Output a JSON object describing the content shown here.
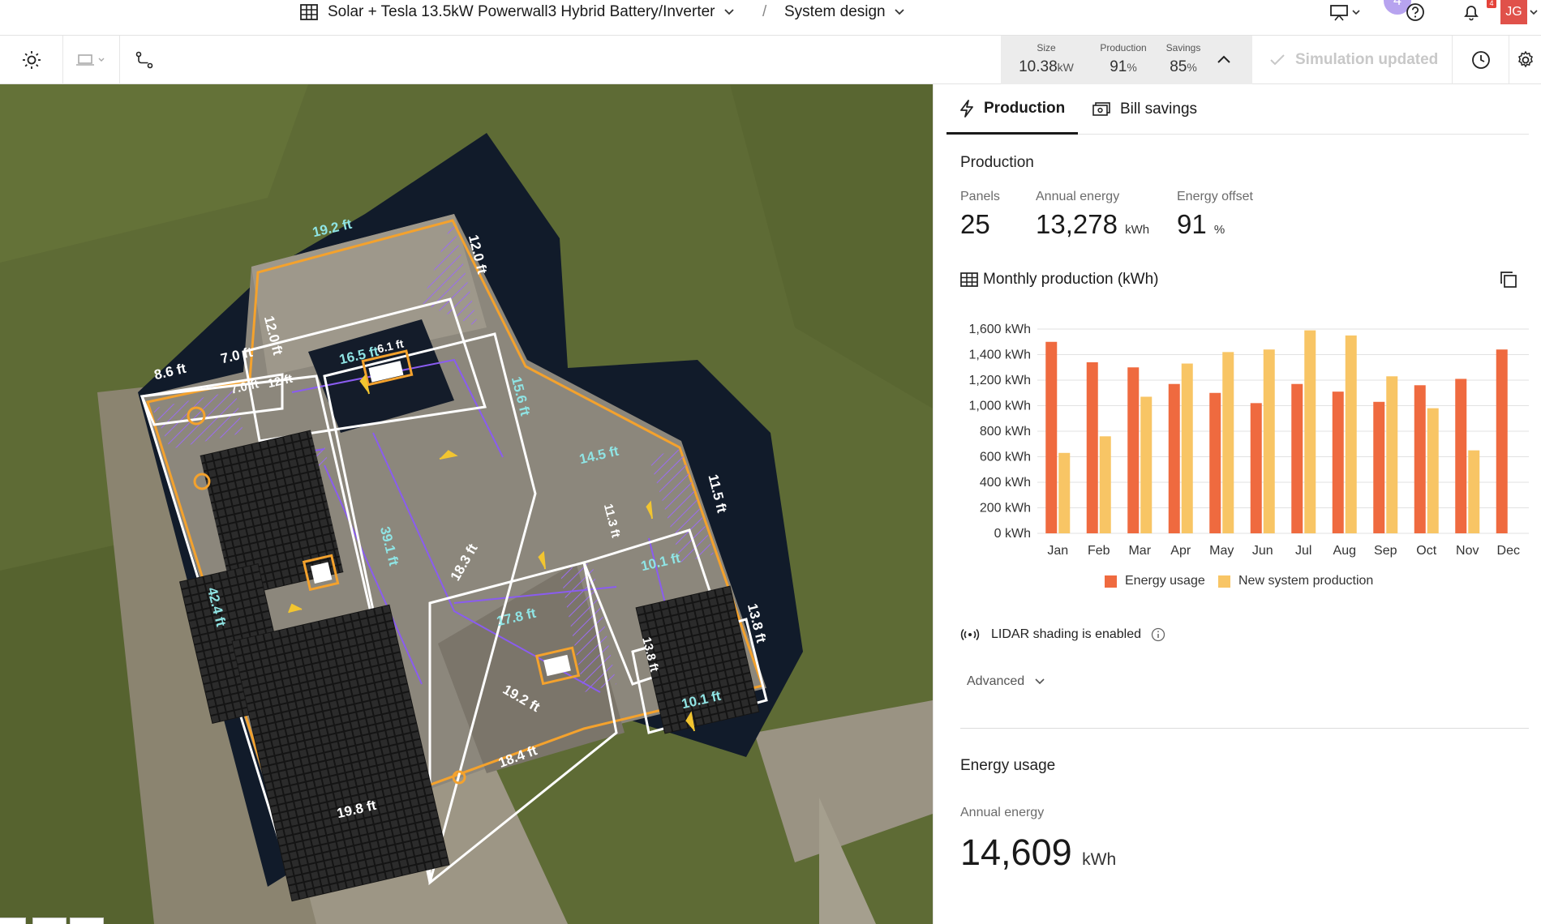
{
  "header": {
    "project_title": "Solar + Tesla 13.5kW Powerwall3 Hybrid Battery/Inverter",
    "separator": "/",
    "section": "System design",
    "badge_count": "4",
    "notification_count": "4",
    "avatar_initials": "JG"
  },
  "toolbar": {
    "stats": [
      {
        "label": "Size",
        "value": "10.38",
        "unit": "kW"
      },
      {
        "label": "Production",
        "value": "91",
        "unit": "%"
      },
      {
        "label": "Savings",
        "value": "85",
        "unit": "%"
      }
    ],
    "simulation_status": "Simulation updated"
  },
  "map": {
    "roof_labels": [
      "19.2 ft",
      "12.0 ft",
      "12.0 ft",
      "8.6 ft",
      "7.0 ft",
      "7.0 ft",
      "12 ft",
      "16.5 ft",
      "6.1 ft",
      "15.6 ft",
      "14.5 ft",
      "11.5 ft",
      "11.3 ft",
      "10.1 ft",
      "39.1 ft",
      "18.3 ft",
      "17.8 ft",
      "42.4 ft",
      "13.8 ft",
      "13.8 ft",
      "10.1 ft",
      "19.2 ft",
      "18.4 ft",
      "19.8 ft"
    ]
  },
  "panel": {
    "tabs": [
      {
        "label": "Production",
        "active": true
      },
      {
        "label": "Bill savings",
        "active": false
      }
    ],
    "production": {
      "title": "Production",
      "metrics": [
        {
          "label": "Panels",
          "value": "25",
          "unit": ""
        },
        {
          "label": "Annual energy",
          "value": "13,278",
          "unit": "kWh"
        },
        {
          "label": "Energy offset",
          "value": "91",
          "unit": "%"
        }
      ],
      "chart_title": "Monthly production (kWh)"
    },
    "lidar_text": "LIDAR shading is enabled",
    "advanced_label": "Advanced",
    "energy_usage": {
      "title": "Energy usage",
      "sub_label": "Annual energy",
      "value": "14,609",
      "unit": "kWh"
    }
  },
  "chart_data": {
    "type": "bar",
    "title": "Monthly production (kWh)",
    "categories": [
      "Jan",
      "Feb",
      "Mar",
      "Apr",
      "May",
      "Jun",
      "Jul",
      "Aug",
      "Sep",
      "Oct",
      "Nov",
      "Dec"
    ],
    "series": [
      {
        "name": "Energy usage",
        "color": "#EF6A3F",
        "values": [
          1500,
          1340,
          1300,
          1170,
          1100,
          1020,
          1170,
          1110,
          1030,
          1160,
          1210,
          1440
        ]
      },
      {
        "name": "New system production",
        "color": "#F8C565",
        "values": [
          630,
          760,
          1070,
          1330,
          1420,
          1440,
          1590,
          1550,
          1230,
          980,
          650,
          0
        ]
      }
    ],
    "ylim": [
      0,
      1600
    ],
    "yticks": [
      0,
      200,
      400,
      600,
      800,
      1000,
      1200,
      1400,
      1600
    ],
    "ytick_labels": [
      "0 kWh",
      "200 kWh",
      "400 kWh",
      "600 kWh",
      "800 kWh",
      "1,000 kWh",
      "1,200 kWh",
      "1,400 kWh",
      "1,600 kWh"
    ],
    "grid": true,
    "legend": "bottom"
  }
}
